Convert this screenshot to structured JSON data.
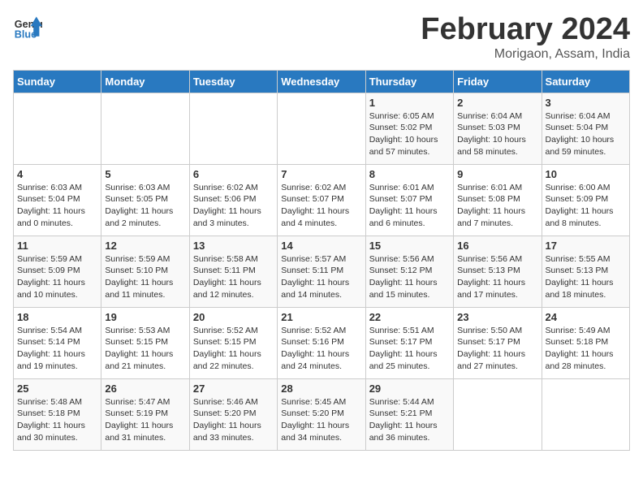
{
  "logo": {
    "line1": "General",
    "line2": "Blue"
  },
  "title": "February 2024",
  "subtitle": "Morigaon, Assam, India",
  "days_of_week": [
    "Sunday",
    "Monday",
    "Tuesday",
    "Wednesday",
    "Thursday",
    "Friday",
    "Saturday"
  ],
  "weeks": [
    [
      {
        "day": "",
        "info": ""
      },
      {
        "day": "",
        "info": ""
      },
      {
        "day": "",
        "info": ""
      },
      {
        "day": "",
        "info": ""
      },
      {
        "day": "1",
        "info": "Sunrise: 6:05 AM\nSunset: 5:02 PM\nDaylight: 10 hours\nand 57 minutes."
      },
      {
        "day": "2",
        "info": "Sunrise: 6:04 AM\nSunset: 5:03 PM\nDaylight: 10 hours\nand 58 minutes."
      },
      {
        "day": "3",
        "info": "Sunrise: 6:04 AM\nSunset: 5:04 PM\nDaylight: 10 hours\nand 59 minutes."
      }
    ],
    [
      {
        "day": "4",
        "info": "Sunrise: 6:03 AM\nSunset: 5:04 PM\nDaylight: 11 hours\nand 0 minutes."
      },
      {
        "day": "5",
        "info": "Sunrise: 6:03 AM\nSunset: 5:05 PM\nDaylight: 11 hours\nand 2 minutes."
      },
      {
        "day": "6",
        "info": "Sunrise: 6:02 AM\nSunset: 5:06 PM\nDaylight: 11 hours\nand 3 minutes."
      },
      {
        "day": "7",
        "info": "Sunrise: 6:02 AM\nSunset: 5:07 PM\nDaylight: 11 hours\nand 4 minutes."
      },
      {
        "day": "8",
        "info": "Sunrise: 6:01 AM\nSunset: 5:07 PM\nDaylight: 11 hours\nand 6 minutes."
      },
      {
        "day": "9",
        "info": "Sunrise: 6:01 AM\nSunset: 5:08 PM\nDaylight: 11 hours\nand 7 minutes."
      },
      {
        "day": "10",
        "info": "Sunrise: 6:00 AM\nSunset: 5:09 PM\nDaylight: 11 hours\nand 8 minutes."
      }
    ],
    [
      {
        "day": "11",
        "info": "Sunrise: 5:59 AM\nSunset: 5:09 PM\nDaylight: 11 hours\nand 10 minutes."
      },
      {
        "day": "12",
        "info": "Sunrise: 5:59 AM\nSunset: 5:10 PM\nDaylight: 11 hours\nand 11 minutes."
      },
      {
        "day": "13",
        "info": "Sunrise: 5:58 AM\nSunset: 5:11 PM\nDaylight: 11 hours\nand 12 minutes."
      },
      {
        "day": "14",
        "info": "Sunrise: 5:57 AM\nSunset: 5:11 PM\nDaylight: 11 hours\nand 14 minutes."
      },
      {
        "day": "15",
        "info": "Sunrise: 5:56 AM\nSunset: 5:12 PM\nDaylight: 11 hours\nand 15 minutes."
      },
      {
        "day": "16",
        "info": "Sunrise: 5:56 AM\nSunset: 5:13 PM\nDaylight: 11 hours\nand 17 minutes."
      },
      {
        "day": "17",
        "info": "Sunrise: 5:55 AM\nSunset: 5:13 PM\nDaylight: 11 hours\nand 18 minutes."
      }
    ],
    [
      {
        "day": "18",
        "info": "Sunrise: 5:54 AM\nSunset: 5:14 PM\nDaylight: 11 hours\nand 19 minutes."
      },
      {
        "day": "19",
        "info": "Sunrise: 5:53 AM\nSunset: 5:15 PM\nDaylight: 11 hours\nand 21 minutes."
      },
      {
        "day": "20",
        "info": "Sunrise: 5:52 AM\nSunset: 5:15 PM\nDaylight: 11 hours\nand 22 minutes."
      },
      {
        "day": "21",
        "info": "Sunrise: 5:52 AM\nSunset: 5:16 PM\nDaylight: 11 hours\nand 24 minutes."
      },
      {
        "day": "22",
        "info": "Sunrise: 5:51 AM\nSunset: 5:17 PM\nDaylight: 11 hours\nand 25 minutes."
      },
      {
        "day": "23",
        "info": "Sunrise: 5:50 AM\nSunset: 5:17 PM\nDaylight: 11 hours\nand 27 minutes."
      },
      {
        "day": "24",
        "info": "Sunrise: 5:49 AM\nSunset: 5:18 PM\nDaylight: 11 hours\nand 28 minutes."
      }
    ],
    [
      {
        "day": "25",
        "info": "Sunrise: 5:48 AM\nSunset: 5:18 PM\nDaylight: 11 hours\nand 30 minutes."
      },
      {
        "day": "26",
        "info": "Sunrise: 5:47 AM\nSunset: 5:19 PM\nDaylight: 11 hours\nand 31 minutes."
      },
      {
        "day": "27",
        "info": "Sunrise: 5:46 AM\nSunset: 5:20 PM\nDaylight: 11 hours\nand 33 minutes."
      },
      {
        "day": "28",
        "info": "Sunrise: 5:45 AM\nSunset: 5:20 PM\nDaylight: 11 hours\nand 34 minutes."
      },
      {
        "day": "29",
        "info": "Sunrise: 5:44 AM\nSunset: 5:21 PM\nDaylight: 11 hours\nand 36 minutes."
      },
      {
        "day": "",
        "info": ""
      },
      {
        "day": "",
        "info": ""
      }
    ]
  ]
}
